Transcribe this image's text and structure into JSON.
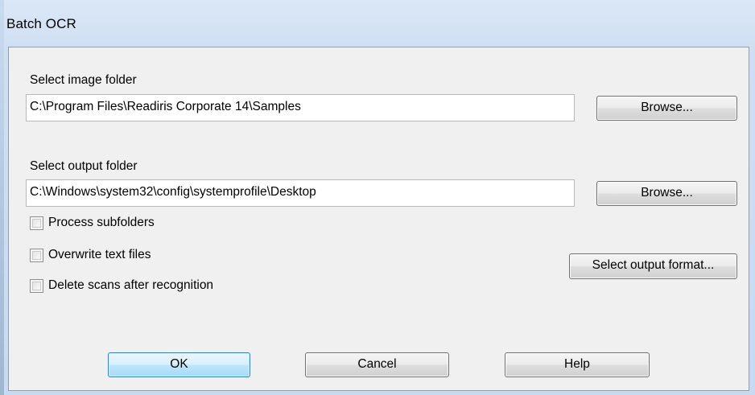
{
  "window": {
    "title": "Batch OCR"
  },
  "image_folder": {
    "label": "Select image folder",
    "value": "C:\\Program Files\\Readiris Corporate 14\\Samples",
    "browse_label": "Browse..."
  },
  "output_folder": {
    "label": "Select output folder",
    "value": "C:\\Windows\\system32\\config\\systemprofile\\Desktop",
    "browse_label": "Browse..."
  },
  "options": {
    "process_subfolders": {
      "label": "Process subfolders",
      "checked": false
    },
    "overwrite_text_files": {
      "label": "Overwrite text files",
      "checked": false
    },
    "delete_scans": {
      "label": "Delete scans after recognition",
      "checked": false
    }
  },
  "buttons": {
    "select_output_format": "Select output format...",
    "ok": "OK",
    "cancel": "Cancel",
    "help": "Help"
  }
}
